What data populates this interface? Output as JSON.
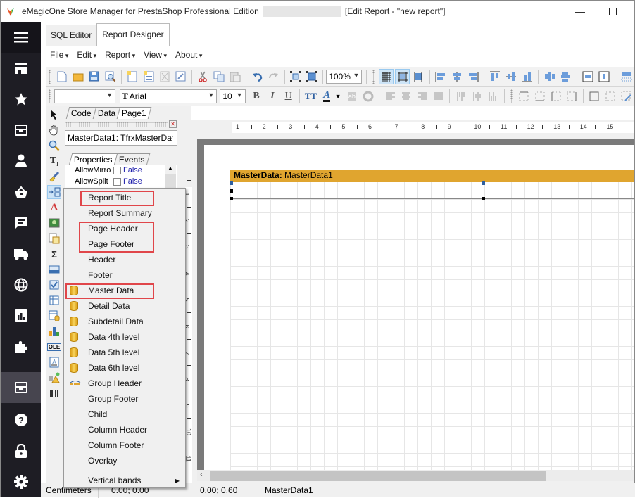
{
  "window": {
    "title": "eMagicOne Store Manager for PrestaShop Professional Edition",
    "subtitle": "[Edit Report - \"new report\"]",
    "minimize_icon": "minimize-icon",
    "maximize_icon": "maximize-icon"
  },
  "sidebar": {
    "items": [
      {
        "icon": "hamburger-menu-icon"
      },
      {
        "icon": "store-icon"
      },
      {
        "icon": "star-icon"
      },
      {
        "icon": "archive-box-icon"
      },
      {
        "icon": "user-icon"
      },
      {
        "icon": "basket-icon"
      },
      {
        "icon": "message-icon"
      },
      {
        "icon": "truck-icon"
      },
      {
        "icon": "globe-icon"
      },
      {
        "icon": "bar-chart-icon"
      },
      {
        "icon": "puzzle-icon"
      },
      {
        "icon": "archive-box-icon",
        "active": true
      },
      {
        "icon": "help-icon"
      },
      {
        "icon": "lock-icon"
      },
      {
        "icon": "gear-icon"
      }
    ]
  },
  "tabs": [
    {
      "label": "SQL Editor",
      "active": false
    },
    {
      "label": "Report Designer",
      "active": true
    }
  ],
  "menubar": [
    "File",
    "Edit",
    "Report",
    "View",
    "About"
  ],
  "toolbar": {
    "zoom": "100%",
    "style_combo": "",
    "font_name": "Arial",
    "font_size": "10",
    "bold": "B",
    "italic": "I",
    "underline": "U"
  },
  "designer_tabs": [
    "Code",
    "Data",
    "Page1"
  ],
  "object_inspector": {
    "selected_object": "MasterData1: TfrxMasterDa",
    "tabs": [
      "Properties",
      "Events"
    ],
    "properties": [
      {
        "name": "AllowMirrorMode",
        "display_name": "AllowMirrorM",
        "value": "False"
      },
      {
        "name": "AllowSplit",
        "display_name": "AllowSplit",
        "value": "False"
      }
    ]
  },
  "ruler": {
    "horizontal": [
      "1",
      "2",
      "3",
      "4",
      "5",
      "6",
      "7",
      "8",
      "9",
      "10",
      "11",
      "12",
      "13",
      "14",
      "15"
    ],
    "vertical": [
      "1",
      "2",
      "3",
      "4",
      "5",
      "6",
      "7",
      "8",
      "9",
      "10",
      "11"
    ]
  },
  "band": {
    "type_label": "MasterData:",
    "name": "MasterData1",
    "color": "#e0a52f"
  },
  "context_menu": {
    "items": [
      {
        "label": "Report Title",
        "icon": null,
        "highlighted": true
      },
      {
        "label": "Report Summary",
        "icon": null
      },
      {
        "label": "Page Header",
        "icon": null,
        "highlighted": true
      },
      {
        "label": "Page Footer",
        "icon": null,
        "highlighted": true
      },
      {
        "label": "Header",
        "icon": null
      },
      {
        "label": "Footer",
        "icon": null
      },
      {
        "label": "Master Data",
        "icon": "database-icon",
        "highlighted": true
      },
      {
        "label": "Detail Data",
        "icon": "database-icon"
      },
      {
        "label": "Subdetail Data",
        "icon": "database-icon"
      },
      {
        "label": "Data 4th level",
        "icon": "database-icon"
      },
      {
        "label": "Data 5th level",
        "icon": "database-icon"
      },
      {
        "label": "Data 6th level",
        "icon": "database-icon"
      },
      {
        "label": "Group Header",
        "icon": "group-header-icon"
      },
      {
        "label": "Group Footer",
        "icon": null
      },
      {
        "label": "Child",
        "icon": null
      },
      {
        "label": "Column Header",
        "icon": null
      },
      {
        "label": "Column Footer",
        "icon": null
      },
      {
        "label": "Overlay",
        "icon": null
      },
      {
        "label": "Vertical bands",
        "icon": null,
        "submenu": true
      }
    ],
    "highlight_color": "#e0464a"
  },
  "statusbar": {
    "units": "Centimeters",
    "position": "0.00; 0.00",
    "size": "0.00; 0.60",
    "object": "MasterData1"
  }
}
